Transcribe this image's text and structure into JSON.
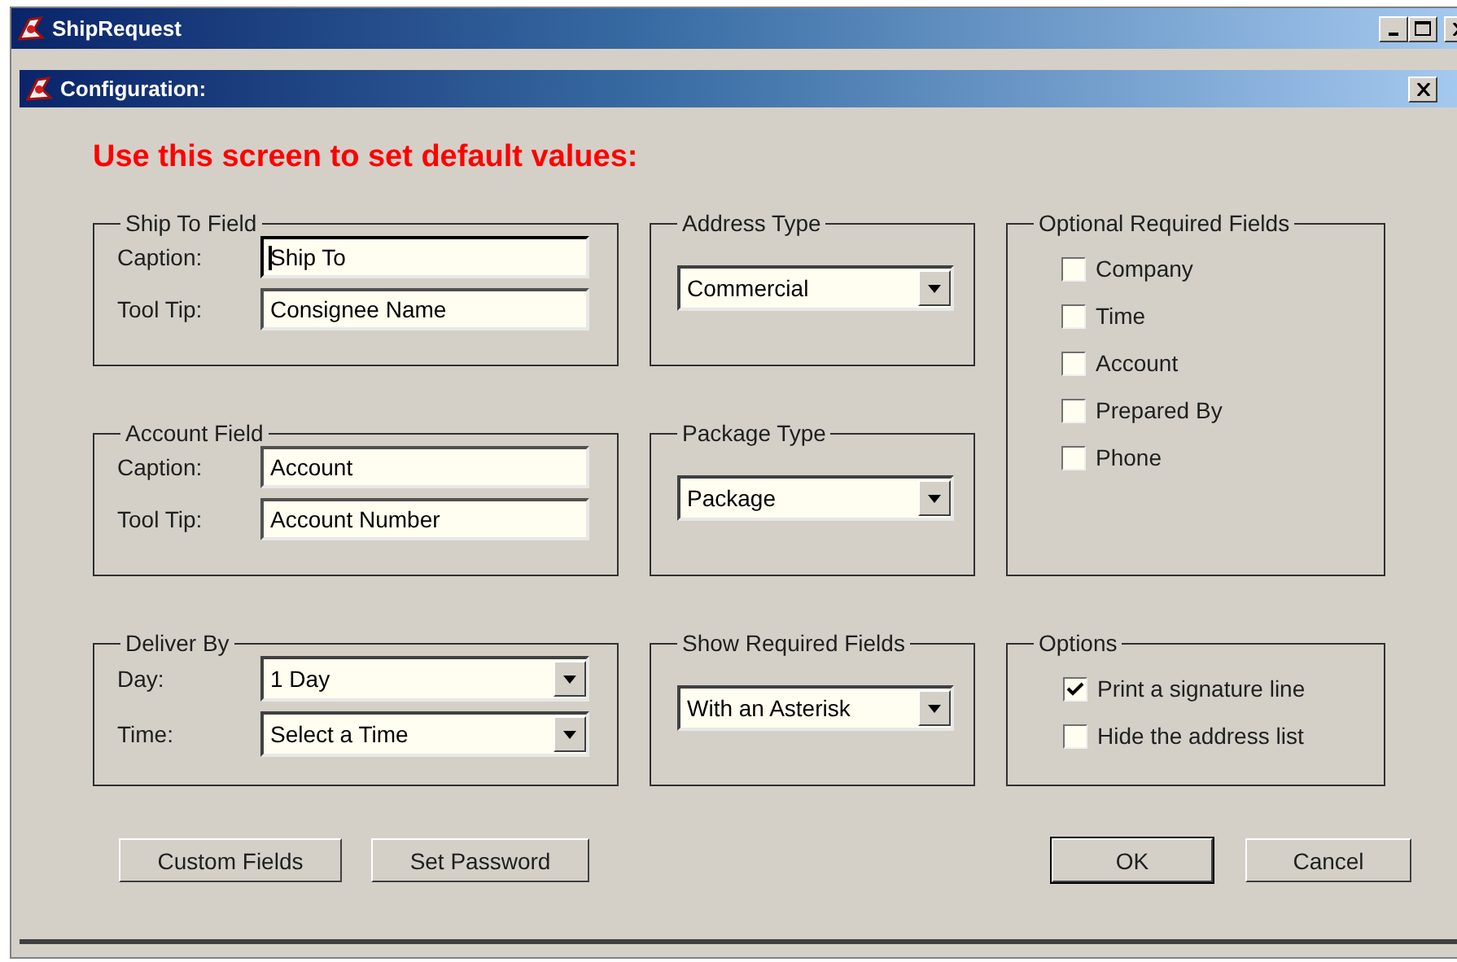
{
  "app_window": {
    "title": "ShipRequest"
  },
  "dialog": {
    "title": "Configuration:"
  },
  "heading": "Use this screen to set default values:",
  "groups": [
    {
      "kind": "fields",
      "title": "Ship To Field",
      "fields": [
        {
          "label": "Caption:",
          "value": "Ship To",
          "focused": true
        },
        {
          "label": "Tool Tip:",
          "value": "Consignee Name",
          "focused": false
        }
      ]
    },
    {
      "kind": "dropdown",
      "title": "Address Type",
      "value": "Commercial"
    },
    {
      "kind": "checks",
      "title": "Optional Required Fields",
      "items": [
        {
          "label": "Company",
          "checked": false
        },
        {
          "label": "Time",
          "checked": false
        },
        {
          "label": "Account",
          "checked": false
        },
        {
          "label": "Prepared By",
          "checked": false
        },
        {
          "label": "Phone",
          "checked": false
        }
      ]
    },
    {
      "kind": "fields",
      "title": "Account Field",
      "fields": [
        {
          "label": "Caption:",
          "value": "Account",
          "focused": false
        },
        {
          "label": "Tool Tip:",
          "value": "Account Number",
          "focused": false
        }
      ]
    },
    {
      "kind": "dropdown",
      "title": "Package Type",
      "value": "Package"
    },
    {
      "kind": "selects",
      "title": "Deliver By",
      "fields": [
        {
          "label": "Day:",
          "value": "1 Day"
        },
        {
          "label": "Time:",
          "value": "Select a Time"
        }
      ]
    },
    {
      "kind": "dropdown",
      "title": "Show Required Fields",
      "value": "With an Asterisk"
    },
    {
      "kind": "checks",
      "title": "Options",
      "items": [
        {
          "label": "Print a signature line",
          "checked": true
        },
        {
          "label": "Hide the address list",
          "checked": false
        }
      ]
    }
  ],
  "left_buttons": [
    {
      "label": "Custom Fields"
    },
    {
      "label": "Set Password"
    }
  ],
  "right_buttons": [
    {
      "label": "OK",
      "default": true
    },
    {
      "label": "Cancel",
      "default": false
    }
  ]
}
